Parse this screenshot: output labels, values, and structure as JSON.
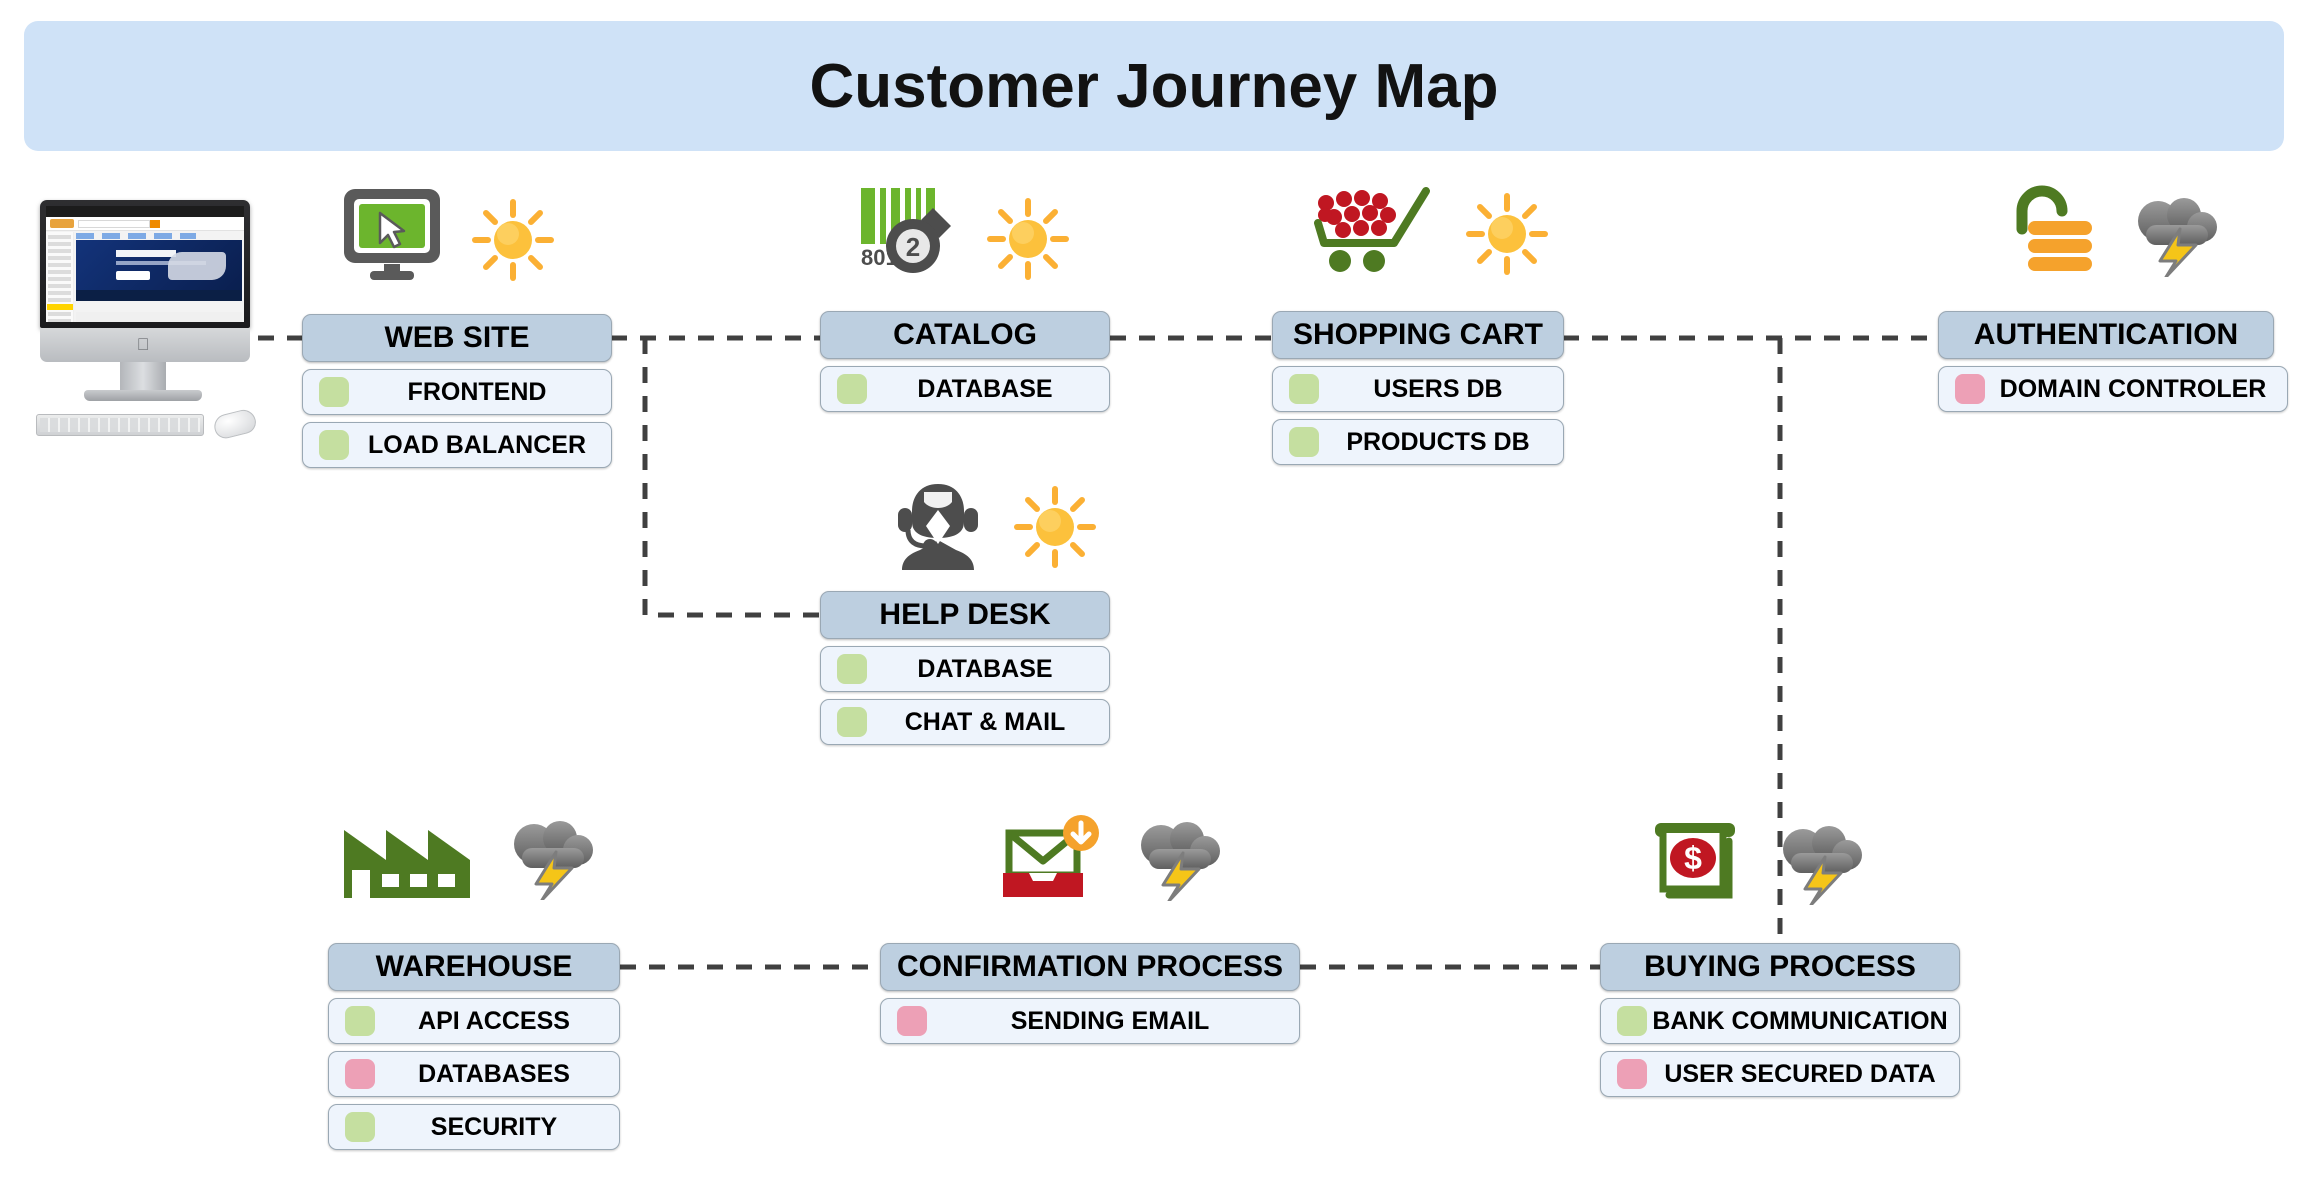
{
  "header": {
    "title": "Customer Journey Map",
    "banner_color": "#cfe2f7"
  },
  "theme": {
    "node_header_fill": "#bdcfe0",
    "node_child_fill": "#eef4fc",
    "chip_green": "#c5dfa0",
    "chip_pink": "#eda0b6",
    "connector_color": "#404040"
  },
  "illustration": {
    "name": "imac-ecommerce-screenshot",
    "caption": "iMac desktop computer showing an e-commerce store page with keyboard and mouse"
  },
  "nodes": [
    {
      "id": "web-site",
      "label": "WEB SITE",
      "icons": [
        "monitor-cursor-icon",
        "sun-icon"
      ],
      "children": [
        {
          "label": "FRONTEND",
          "status": "green"
        },
        {
          "label": "LOAD BALANCER",
          "status": "green"
        }
      ]
    },
    {
      "id": "catalog",
      "label": "CATALOG",
      "icons": [
        "barcode-scanner-icon",
        "sun-icon"
      ],
      "icon_text": "801",
      "icon_badge": "2",
      "children": [
        {
          "label": "DATABASE",
          "status": "green"
        }
      ]
    },
    {
      "id": "shopping-cart",
      "label": "SHOPPING CART",
      "icons": [
        "shopping-cart-icon",
        "sun-icon"
      ],
      "children": [
        {
          "label": "USERS DB",
          "status": "green"
        },
        {
          "label": "PRODUCTS DB",
          "status": "green"
        }
      ]
    },
    {
      "id": "authentication",
      "label": "AUTHENTICATION",
      "icons": [
        "padlock-icon",
        "storm-cloud-icon"
      ],
      "children": [
        {
          "label": "DOMAIN CONTROLER",
          "status": "pink"
        }
      ]
    },
    {
      "id": "help-desk",
      "label": "HELP DESK",
      "icons": [
        "headset-agent-icon",
        "sun-icon"
      ],
      "children": [
        {
          "label": "DATABASE",
          "status": "green"
        },
        {
          "label": "CHAT & MAIL",
          "status": "green"
        }
      ]
    },
    {
      "id": "warehouse",
      "label": "WAREHOUSE",
      "icons": [
        "factory-icon",
        "storm-cloud-icon"
      ],
      "children": [
        {
          "label": "API ACCESS",
          "status": "green"
        },
        {
          "label": "DATABASES",
          "status": "pink"
        },
        {
          "label": "SECURITY",
          "status": "green"
        }
      ]
    },
    {
      "id": "confirmation-process",
      "label": "CONFIRMATION PROCESS",
      "icons": [
        "email-inbox-icon",
        "storm-cloud-icon"
      ],
      "children": [
        {
          "label": "SENDING EMAIL",
          "status": "pink"
        }
      ]
    },
    {
      "id": "buying-process",
      "label": "BUYING PROCESS",
      "icons": [
        "atm-cash-icon",
        "storm-cloud-icon"
      ],
      "children": [
        {
          "label": "BANK COMMUNICATION",
          "status": "green"
        },
        {
          "label": "USER SECURED DATA",
          "status": "pink"
        }
      ]
    }
  ],
  "connections": [
    {
      "from": "imac-illustration",
      "to": "web-site"
    },
    {
      "from": "web-site",
      "to": "catalog"
    },
    {
      "from": "web-site",
      "to": "help-desk"
    },
    {
      "from": "catalog",
      "to": "shopping-cart"
    },
    {
      "from": "shopping-cart",
      "to": "authentication"
    },
    {
      "from": "shopping-cart",
      "to": "buying-process"
    },
    {
      "from": "warehouse",
      "to": "confirmation-process"
    },
    {
      "from": "confirmation-process",
      "to": "buying-process"
    }
  ]
}
